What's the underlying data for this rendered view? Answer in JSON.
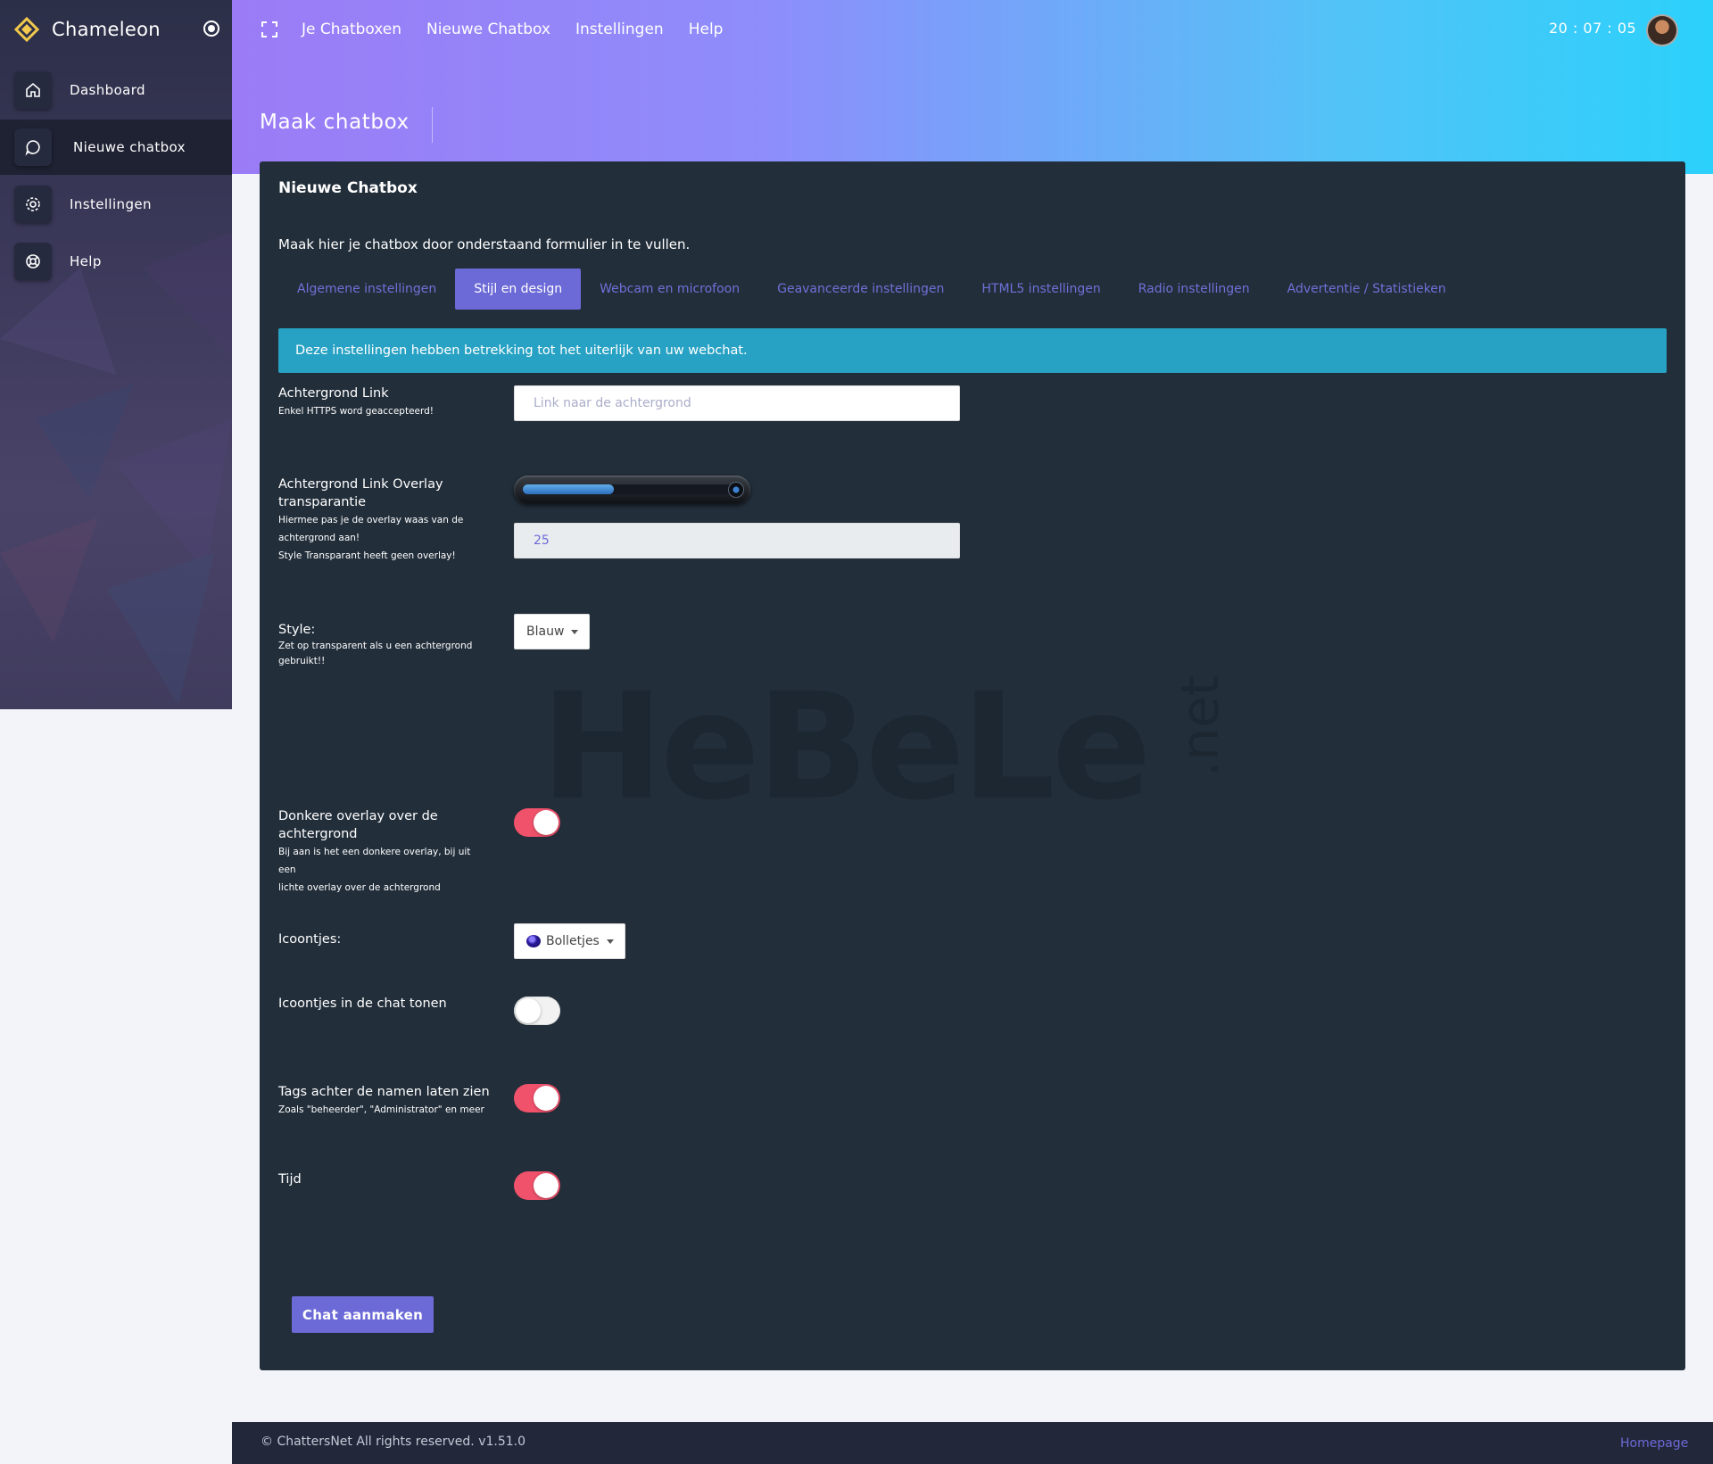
{
  "brand": {
    "name": "Chameleon"
  },
  "sidebar": {
    "items": [
      {
        "label": "Dashboard",
        "icon": "home-icon"
      },
      {
        "label": "Nieuwe chatbox",
        "icon": "chat-icon",
        "active": true
      },
      {
        "label": "Instellingen",
        "icon": "gear-icon"
      },
      {
        "label": "Help",
        "icon": "lifebuoy-icon"
      }
    ]
  },
  "topnav": {
    "links": [
      "Je Chatboxen",
      "Nieuwe Chatbox",
      "Instellingen",
      "Help"
    ],
    "clock": "20 : 07 : 05"
  },
  "page": {
    "title": "Maak chatbox"
  },
  "card": {
    "title": "Nieuwe Chatbox",
    "description": "Maak hier je chatbox door onderstaand formulier in te vullen.",
    "tabs": [
      "Algemene instellingen",
      "Stijl en design",
      "Webcam en microfoon",
      "Geavanceerde instellingen",
      "HTML5 instellingen",
      "Radio instellingen",
      "Advertentie / Statistieken"
    ],
    "active_tab": "Stijl en design",
    "alert": "Deze instellingen hebben betrekking tot het uiterlijk van uw webchat."
  },
  "form": {
    "background_link": {
      "label": "Achtergrond Link",
      "sub": "Enkel HTTPS word geaccepteerd!",
      "placeholder": "Link naar de achtergrond"
    },
    "overlay_transparency": {
      "label_line1": "Achtergrond Link Overlay",
      "label_line2": "transparantie",
      "sub_line1": "Hiermee pas je de overlay waas van de",
      "sub_line2": "achtergrond aan!",
      "sub_line3": "Style Transparant heeft geen overlay!",
      "value": "25",
      "slider_fraction": 0.42
    },
    "style": {
      "label": "Style:",
      "sub_line1": "Zet op transparent als u een achtergrond",
      "sub_line2": "gebruikt!!",
      "selected": "Blauw"
    },
    "dark_overlay": {
      "label_line1": "Donkere overlay over de",
      "label_line2": "achtergrond",
      "sub_line1": "Bij aan is het een donkere overlay, bij uit een",
      "sub_line2": "lichte overlay over de achtergrond",
      "on": true
    },
    "icons": {
      "label": "Icoontjes:",
      "selected": "Bolletjes"
    },
    "icons_in_chat": {
      "label": "Icoontjes in de chat tonen",
      "on": false
    },
    "tags": {
      "label": "Tags achter de namen laten zien",
      "sub": "Zoals \"beheerder\", \"Administrator\" en meer",
      "on": true
    },
    "time": {
      "label": "Tijd",
      "on": true
    },
    "submit": "Chat aanmaken"
  },
  "watermark": {
    "main": "HeBeLe",
    "suffix": ".net"
  },
  "footer": {
    "copyright": "© ChattersNet All rights reserved. v1.51.0",
    "link": "Homepage"
  },
  "colors": {
    "accent": "#6c6ad7",
    "alert": "#28a2c4",
    "toggle_on": "#f0526b",
    "card_bg": "#222e3a"
  }
}
